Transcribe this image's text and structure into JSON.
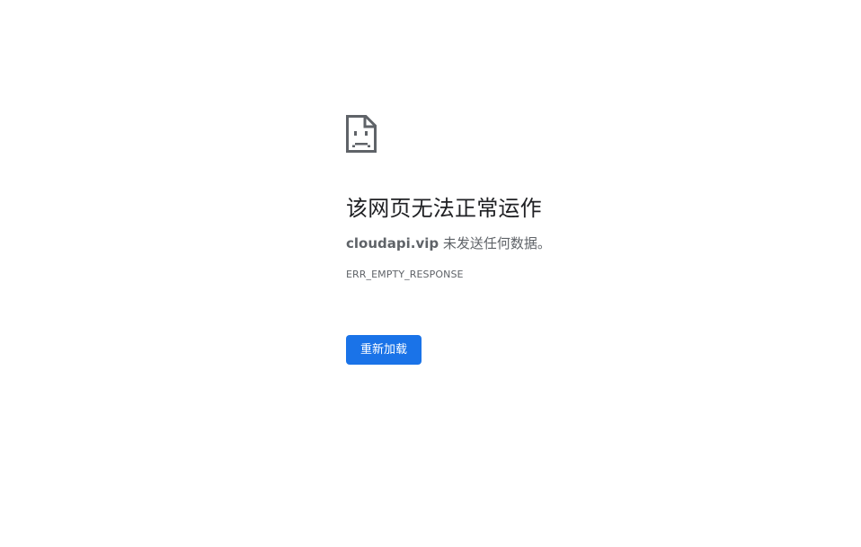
{
  "error": {
    "heading": "该网页无法正常运作",
    "host": "cloudapi.vip",
    "message": "未发送任何数据。",
    "code": "ERR_EMPTY_RESPONSE",
    "reload_label": "重新加载"
  },
  "colors": {
    "accent": "#1a73e8",
    "heading": "#202124",
    "body_text": "#5f6368"
  },
  "icons": {
    "error": "sad-page-icon"
  }
}
